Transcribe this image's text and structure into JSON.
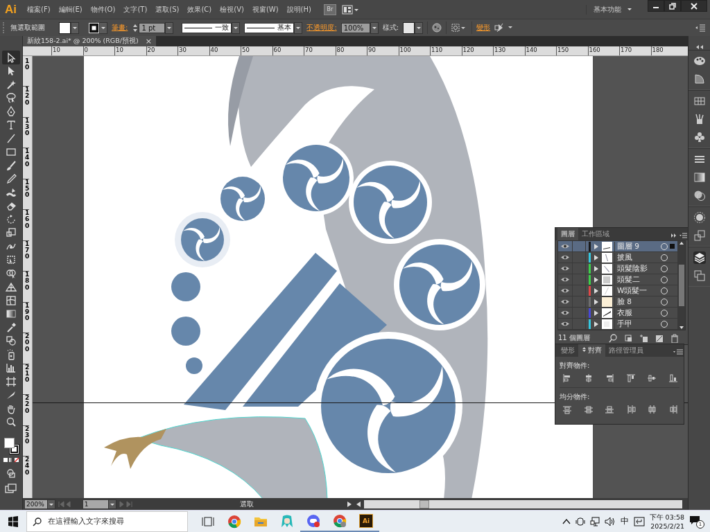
{
  "app_bar": {
    "logo": "Ai",
    "menu": [
      "檔案(F)",
      "編輯(E)",
      "物件(O)",
      "文字(T)",
      "選取(S)",
      "效果(C)",
      "檢視(V)",
      "視窗(W)",
      "說明(H)"
    ],
    "bridge": "Br",
    "workspace": "基本功能"
  },
  "control_bar": {
    "selection": "無選取範圍",
    "stroke_label": "筆畫:",
    "stroke_weight": "1 pt",
    "profile": "一致",
    "brush": "基本",
    "opacity_label": "不透明度:",
    "opacity": "100%",
    "style_label": "樣式:",
    "transform_link": "變形"
  },
  "document_tab": {
    "title": "新紋158-2.ai* @ 200% (RGB/預視)",
    "close": "×"
  },
  "rulers": {
    "horizontal": [
      "10",
      "0",
      "10",
      "20",
      "30",
      "40",
      "50",
      "60",
      "70",
      "80",
      "90",
      "100",
      "110",
      "120",
      "130",
      "140",
      "150",
      "160",
      "170",
      "180"
    ],
    "vertical": [
      "10",
      "120",
      "130",
      "140",
      "150",
      "160",
      "170",
      "180",
      "190",
      "200",
      "210",
      "220",
      "230",
      "240"
    ]
  },
  "tools": [
    {
      "kind": "select",
      "selected": true
    },
    {
      "kind": "direct",
      "selected": false
    },
    {
      "kind": "wand",
      "selected": false
    },
    {
      "kind": "lasso",
      "selected": false
    },
    {
      "kind": "pen",
      "selected": false
    },
    {
      "kind": "type",
      "selected": false
    },
    {
      "kind": "line",
      "selected": false
    },
    {
      "kind": "rect",
      "selected": false
    },
    {
      "kind": "brush",
      "selected": false
    },
    {
      "kind": "pencil",
      "selected": false
    },
    {
      "kind": "blob",
      "selected": false
    },
    {
      "kind": "eraser",
      "selected": false
    },
    {
      "kind": "rotate",
      "selected": false
    },
    {
      "kind": "scale",
      "selected": false
    },
    {
      "kind": "warp",
      "selected": false
    },
    {
      "kind": "free",
      "selected": false
    },
    {
      "kind": "builder",
      "selected": false
    },
    {
      "kind": "perspective",
      "selected": false
    },
    {
      "kind": "mesh",
      "selected": false
    },
    {
      "kind": "gradient",
      "selected": false
    },
    {
      "kind": "eyedropper",
      "selected": false
    },
    {
      "kind": "blend",
      "selected": false
    },
    {
      "kind": "symbol",
      "selected": false
    },
    {
      "kind": "graph",
      "selected": false
    },
    {
      "kind": "artboard",
      "selected": false
    },
    {
      "kind": "slice",
      "selected": false
    },
    {
      "kind": "hand",
      "selected": false
    },
    {
      "kind": "zoom",
      "selected": false
    }
  ],
  "layers_panel": {
    "tabs": [
      {
        "label": "圖層",
        "selected": true
      },
      {
        "label": "工作區域",
        "selected": false
      }
    ],
    "layers": [
      {
        "name": "圖層 9",
        "color": "#1a1a1a",
        "selected": true
      },
      {
        "name": "披風",
        "color": "#36c8e0",
        "selected": false
      },
      {
        "name": "頭髮陰影",
        "color": "#3ed04a",
        "selected": false
      },
      {
        "name": "頭髮二",
        "color": "#3ed04a",
        "selected": false
      },
      {
        "name": "W頭髮一",
        "color": "#e04848",
        "selected": false
      },
      {
        "name": "臉 8",
        "color": "#6e6e6e",
        "selected": false
      },
      {
        "name": "衣服",
        "color": "#4848d8",
        "selected": false
      },
      {
        "name": "手甲",
        "color": "#36c8e0",
        "selected": false
      }
    ],
    "count": "11 個圖層"
  },
  "align_panel": {
    "tabs": [
      {
        "label": "變形",
        "selected": false
      },
      {
        "label": "對齊",
        "selected": true
      },
      {
        "label": "路徑管理員",
        "selected": false
      }
    ],
    "align_label": "對齊物件:",
    "distribute_label": "均分物件:"
  },
  "status_bar": {
    "zoom": "200%",
    "artboard": "1",
    "tool": "選取"
  },
  "taskbar": {
    "search_placeholder": "在這裡輸入文字來搜尋",
    "app_label": "Ai",
    "ime": "中",
    "time": "下午 03:58",
    "date": "2025/2/21",
    "notifications": "1"
  }
}
